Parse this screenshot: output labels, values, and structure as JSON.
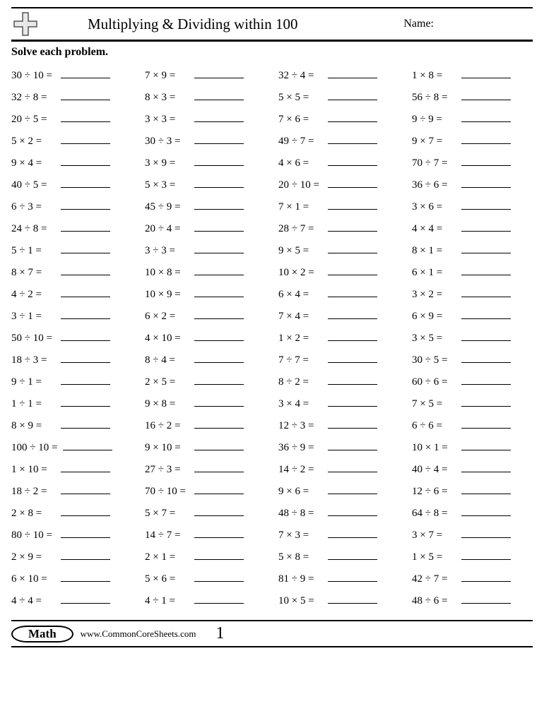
{
  "header": {
    "title": "Multiplying & Dividing within 100",
    "name_label": "Name:"
  },
  "instructions": "Solve each problem.",
  "problems": [
    [
      "30 ÷ 10 =",
      "7 × 9 =",
      "32 ÷ 4 =",
      "1 × 8 ="
    ],
    [
      "32 ÷ 8 =",
      "8 × 3 =",
      "5 × 5 =",
      "56 ÷ 8 ="
    ],
    [
      "20 ÷ 5 =",
      "3 × 3 =",
      "7 × 6 =",
      "9 ÷ 9 ="
    ],
    [
      "5 × 2 =",
      "30 ÷ 3 =",
      "49 ÷ 7 =",
      "9 × 7 ="
    ],
    [
      "9 × 4 =",
      "3 × 9 =",
      "4 × 6 =",
      "70 ÷ 7 ="
    ],
    [
      "40 ÷ 5 =",
      "5 × 3 =",
      "20 ÷ 10 =",
      "36 ÷ 6 ="
    ],
    [
      "6 ÷ 3 =",
      "45 ÷ 9 =",
      "7 × 1 =",
      "3 × 6 ="
    ],
    [
      "24 ÷ 8 =",
      "20 ÷ 4 =",
      "28 ÷ 7 =",
      "4 × 4 ="
    ],
    [
      "5 ÷ 1 =",
      "3 ÷ 3 =",
      "9 × 5 =",
      "8 × 1 ="
    ],
    [
      "8 × 7 =",
      "10 × 8 =",
      "10 × 2 =",
      "6 × 1 ="
    ],
    [
      "4 ÷ 2 =",
      "10 × 9 =",
      "6 × 4 =",
      "3 × 2 ="
    ],
    [
      "3 ÷ 1 =",
      "6 × 2 =",
      "7 × 4 =",
      "6 × 9 ="
    ],
    [
      "50 ÷ 10 =",
      "4 × 10 =",
      "1 × 2 =",
      "3 × 5 ="
    ],
    [
      "18 ÷ 3 =",
      "8 ÷ 4 =",
      "7 ÷ 7 =",
      "30 ÷ 5 ="
    ],
    [
      "9 ÷ 1 =",
      "2 × 5 =",
      "8 ÷ 2 =",
      "60 ÷ 6 ="
    ],
    [
      "1 ÷ 1 =",
      "9 × 8 =",
      "3 × 4 =",
      "7 × 5 ="
    ],
    [
      "8 × 9 =",
      "16 ÷ 2 =",
      "12 ÷ 3 =",
      "6 ÷ 6 ="
    ],
    [
      "100 ÷ 10 =",
      "9 × 10 =",
      "36 ÷ 9 =",
      "10 × 1 ="
    ],
    [
      "1 × 10 =",
      "27 ÷ 3 =",
      "14 ÷ 2 =",
      "40 ÷ 4 ="
    ],
    [
      "18 ÷ 2 =",
      "70 ÷ 10 =",
      "9 × 6 =",
      "12 ÷ 6 ="
    ],
    [
      "2 × 8 =",
      "5 × 7 =",
      "48 ÷ 8 =",
      "64 ÷ 8 ="
    ],
    [
      "80 ÷ 10 =",
      "14 ÷ 7 =",
      "7 × 3 =",
      "3 × 7 ="
    ],
    [
      "2 × 9 =",
      "2 × 1 =",
      "5 × 8 =",
      "1 × 5 ="
    ],
    [
      "6 × 10 =",
      "5 × 6 =",
      "81 ÷ 9 =",
      "42 ÷ 7 ="
    ],
    [
      "4 ÷ 4 =",
      "4 ÷ 1 =",
      "10 × 5 =",
      "48 ÷ 6 ="
    ]
  ],
  "footer": {
    "subject": "Math",
    "url": "www.CommonCoreSheets.com",
    "page": "1"
  }
}
